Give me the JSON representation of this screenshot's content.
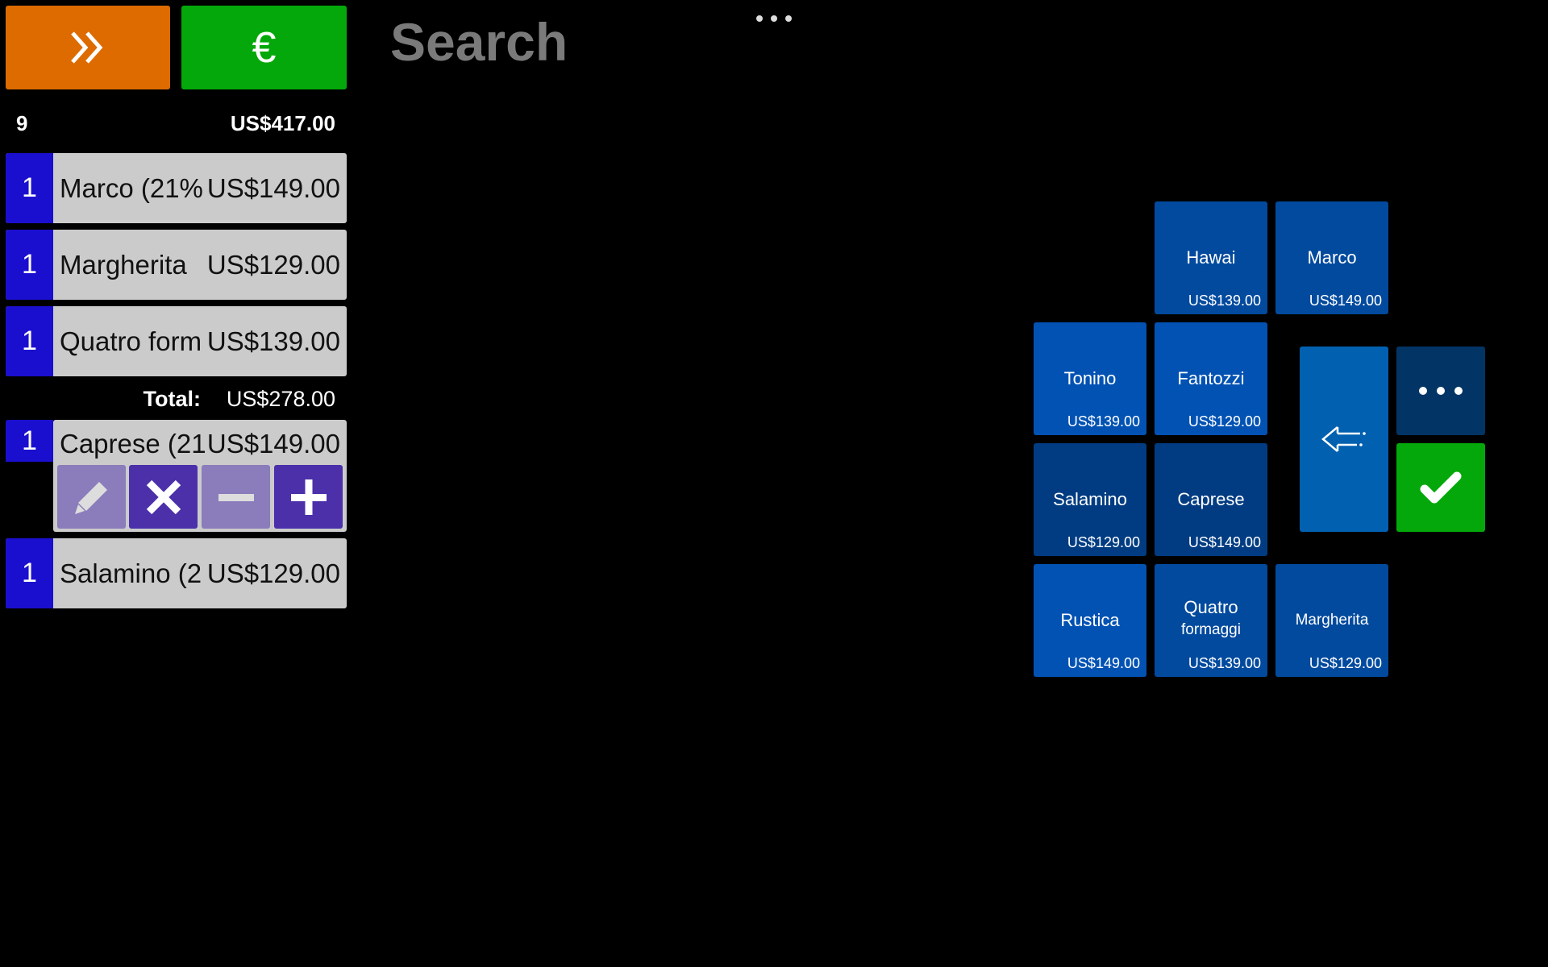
{
  "header": {
    "forward_icon": "double-chevron-right-icon",
    "pay_icon": "euro-icon",
    "pay_symbol": "€",
    "search_label": "Search",
    "menu_icon": "more-dots-icon"
  },
  "order": {
    "item_count": "9",
    "grand_total": "US$417.00",
    "items_before_total": [
      {
        "qty": "1",
        "name": "Marco (21%",
        "price": "US$149.00"
      },
      {
        "qty": "1",
        "name": "Margherita",
        "price": "US$129.00"
      },
      {
        "qty": "1",
        "name": "Quatro form",
        "price": "US$139.00"
      }
    ],
    "subtotal_label": "Total:",
    "subtotal_value": "US$278.00",
    "selected_item": {
      "qty": "1",
      "name": "Caprese (21",
      "price": "US$149.00"
    },
    "selected_actions": [
      "edit",
      "delete",
      "decrease",
      "increase"
    ],
    "items_after": [
      {
        "qty": "1",
        "name": "Salamino (2",
        "price": "US$129.00"
      }
    ]
  },
  "products": [
    {
      "name": "Hawai",
      "price": "US$139.00"
    },
    {
      "name": "Marco",
      "price": "US$149.00"
    },
    {
      "name": "Tonino",
      "price": "US$139.00"
    },
    {
      "name": "Fantozzi",
      "price": "US$129.00"
    },
    {
      "name": "Salamino",
      "price": "US$129.00"
    },
    {
      "name": "Caprese",
      "price": "US$149.00"
    },
    {
      "name": "Rustica",
      "price": "US$149.00"
    },
    {
      "name_line1": "Quatro",
      "name_line2": "formaggi",
      "price": "US$139.00"
    },
    {
      "name": "Margherita",
      "price": "US$129.00"
    }
  ],
  "controls": {
    "back_icon": "back-arrow-icon",
    "more_icon": "more-dots-icon",
    "confirm_icon": "checkmark-icon"
  },
  "colors": {
    "forward_button": "#dd6b00",
    "pay_button": "#04a80a",
    "qty_block": "#1a0fcf",
    "row_bg": "#cbcbcb",
    "tile_blue": "#0252b3",
    "confirm": "#04a80a"
  }
}
